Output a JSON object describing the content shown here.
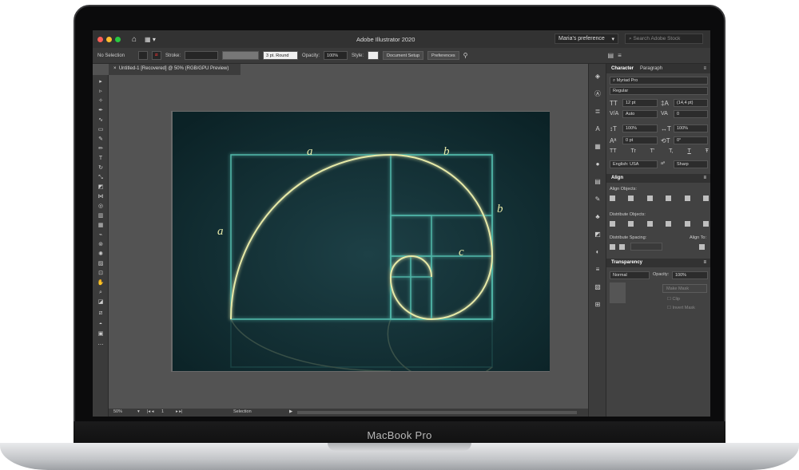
{
  "device": {
    "brand": "MacBook Pro"
  },
  "window": {
    "app_title": "Adobe Illustrator 2020",
    "workspace": "Maria's preference",
    "search_placeholder": "Search Adobe Stock"
  },
  "control_bar": {
    "selection": "No Selection",
    "stroke_label": "Stroke:",
    "stroke_profile": "3 pt. Round",
    "opacity_label": "Opacity:",
    "opacity_value": "100%",
    "style_label": "Style:",
    "document_setup": "Document Setup",
    "preferences": "Preferences"
  },
  "document": {
    "tab_title": "Untitled-1 [Recovered] @ 50% (RGB/GPU Preview)"
  },
  "artwork": {
    "labels": {
      "a_top": "a",
      "b_top": "b",
      "a_left": "a",
      "b_right": "b",
      "c": "c"
    },
    "colors": {
      "background": "#0f2a2e",
      "rect_stroke": "#4fb3a6",
      "spiral_stroke": "#e6e9a8"
    }
  },
  "status_bar": {
    "zoom": "50%",
    "page": "1",
    "mode": "Selection"
  },
  "character_panel": {
    "tab_character": "Character",
    "tab_paragraph": "Paragraph",
    "font_family": "Myriad Pro",
    "font_style": "Regular",
    "font_size": "12 pt",
    "leading": "(14,4 pt)",
    "kerning": "Auto",
    "tracking": "0",
    "vertical_scale": "100%",
    "horizontal_scale": "100%",
    "baseline_shift": "0 pt",
    "rotation": "0°",
    "language": "English: USA",
    "antialias": "Sharp",
    "tt_labels": [
      "TT",
      "Tr",
      "T'",
      "T,",
      "T",
      "Ŧ"
    ]
  },
  "align_panel": {
    "title": "Align",
    "align_objects": "Align Objects:",
    "distribute_objects": "Distribute Objects:",
    "distribute_spacing": "Distribute Spacing:",
    "align_to": "Align To:"
  },
  "transparency_panel": {
    "title": "Transparency",
    "blend_mode": "Normal",
    "opacity_label": "Opacity:",
    "opacity_value": "100%",
    "make_mask": "Make Mask",
    "clip": "Clip",
    "invert_mask": "Invert Mask"
  }
}
